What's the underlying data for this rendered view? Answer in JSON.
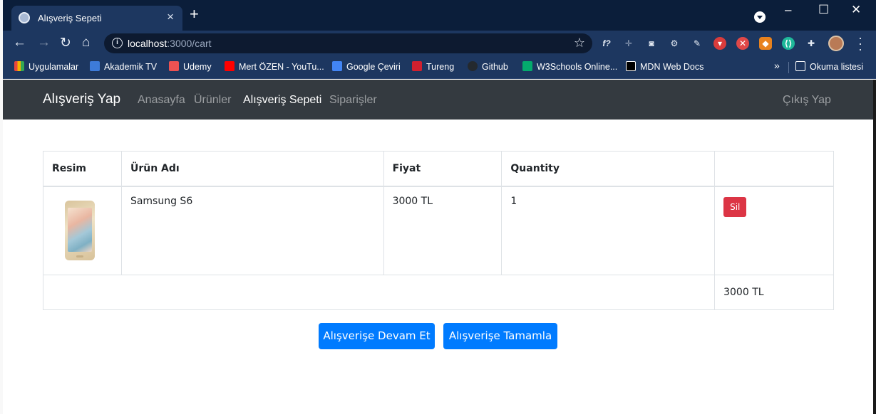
{
  "browser": {
    "tab_title": "Alışveriş Sepeti",
    "url_host": "localhost",
    "url_path": ":3000/cart",
    "bookmarks": [
      {
        "label": "Uygulamalar",
        "color": "#e8453c"
      },
      {
        "label": "Akademik TV",
        "color": "#3d7bd9"
      },
      {
        "label": "Udemy",
        "color": "#ec5252"
      },
      {
        "label": "Mert ÖZEN - YouTu...",
        "color": "#ff0000"
      },
      {
        "label": "Google Çeviri",
        "color": "#4285f4"
      },
      {
        "label": "Tureng",
        "color": "#d1202f"
      },
      {
        "label": "Github",
        "color": "#24292e"
      },
      {
        "label": "W3Schools Online...",
        "color": "#04aa6d"
      },
      {
        "label": "MDN Web Docs",
        "color": "#000000"
      }
    ],
    "reading_list": "Okuma listesi"
  },
  "navbar": {
    "brand": "Alışveriş Yap",
    "links": [
      "Anasayfa",
      "Ürünler",
      "Alışveriş Sepeti",
      "Siparişler"
    ],
    "active_link": "Alışveriş Sepeti",
    "logout": "Çıkış Yap"
  },
  "cart": {
    "headers": [
      "Resim",
      "Ürün Adı",
      "Fiyat",
      "Quantity",
      ""
    ],
    "rows": [
      {
        "name": "Samsung S6",
        "price": "3000 TL",
        "quantity": "1",
        "delete_label": "Sil"
      }
    ],
    "total": "3000 TL"
  },
  "actions": {
    "continue_label": "Alışverişe Devam Et",
    "complete_label": "Alışverişe Tamamla"
  },
  "colors": {
    "primary": "#007bff",
    "danger": "#dc3545",
    "navbar_bg": "#343a40"
  }
}
